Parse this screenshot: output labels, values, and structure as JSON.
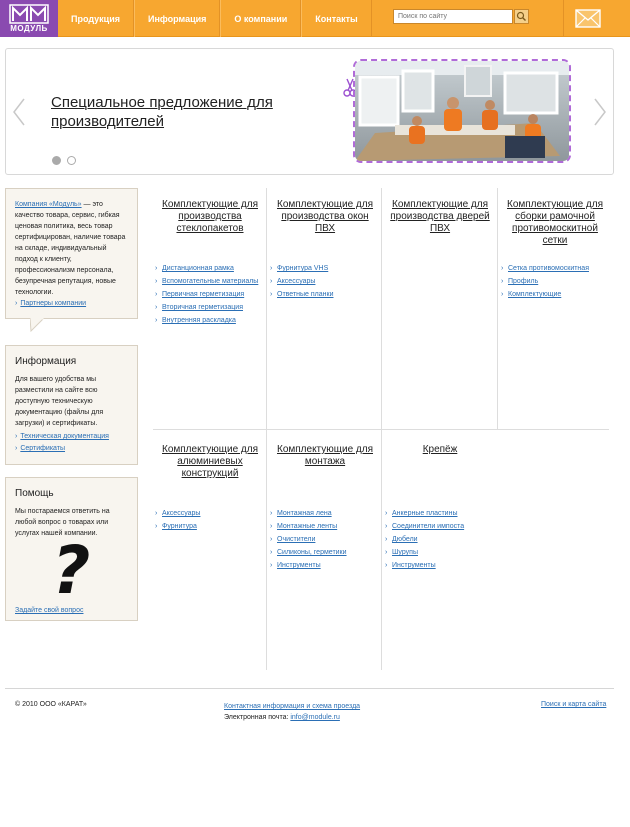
{
  "header": {
    "logo_text": "МОДУЛЬ",
    "nav": [
      "Продукция",
      "Информация",
      "О компании",
      "Контакты"
    ],
    "search_placeholder": "Поиск по сайту"
  },
  "banner": {
    "title": "Специальное предложение для производителей"
  },
  "sidebar": {
    "about": {
      "link": "Компания «Модуль»",
      "text": " — это качество товара, сервис, гибкая ценовая политика, весь товар сертифицирован, наличие товара на складе, индивидуальный подход к клиенту, профессионализм персонала, безупречная репутация, новые технологии.",
      "partners": "Партнеры компании"
    },
    "info": {
      "title": "Информация",
      "text": "Для вашего удобства мы разместили на сайте всю доступную техническую документацию (файлы для загрузки) и сертификаты.",
      "links": [
        "Техническая документация",
        "Сертификаты"
      ]
    },
    "help": {
      "title": "Помощь",
      "text": "Мы постараемся ответить на любой вопрос о товарах или услугах нашей компании.",
      "qmark": "?",
      "ask": "Задайте свой вопрос"
    }
  },
  "categories": [
    {
      "title": "Комплектующие для производства стеклопакетов",
      "items": [
        "Дистанционная рамка",
        "Вспомогательные материалы",
        "Первичная герметизация",
        "Вторичная герметизация",
        "Внутренняя раскладка"
      ]
    },
    {
      "title": "Комплектующие для производства окон ПВХ",
      "items": [
        "Фурнитура VHS",
        "Аксессуары",
        "Ответные планки"
      ]
    },
    {
      "title": "Комплектующие для производства дверей ПВХ",
      "items": []
    },
    {
      "title": "Комплектующие для сборки рамочной противомоскитной сетки",
      "items": [
        "Сетка противомоскитная",
        "Профиль",
        "Комплектующие"
      ]
    },
    {
      "title": "Комплектующие для алюминиевых конструкций",
      "items": [
        "Аксессуары",
        "Фурнитура"
      ]
    },
    {
      "title": "Комплектующие для монтажа",
      "items": [
        "Монтажная лена",
        "Монтажные ленты",
        "Очистители",
        "Силиконы, герметики",
        "Инструменты"
      ]
    },
    {
      "title": "Крепёж",
      "items": [
        "Анкерные пластины",
        "Соединители импоста",
        "Дюбели",
        "Шурупы",
        "Инструменты"
      ]
    }
  ],
  "footer": {
    "copyright": "© 2010 ООО «КАРАТ»",
    "contact_link": "Контактная информация и схема проезда",
    "email_label": "Электронная почта: ",
    "email": "info@module.ru",
    "search_link": "Поиск и карта сайта"
  },
  "colors": {
    "header": "#f7a730",
    "logo": "#8a4ab0",
    "link": "#2b6fb5",
    "sidebar_bg": "#f8f5ef"
  },
  "icons": [
    "logo-icon",
    "search-icon",
    "mail-icon",
    "arrow-left-icon",
    "arrow-right-icon",
    "scissors-icon",
    "chevron-right-icon",
    "question-mark-icon"
  ]
}
